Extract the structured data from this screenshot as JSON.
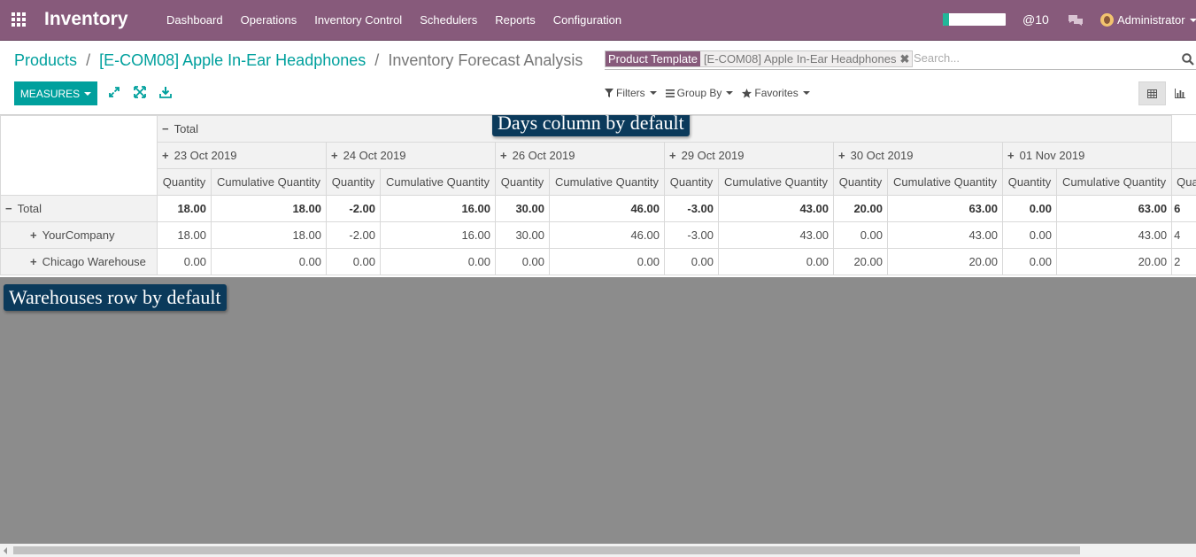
{
  "navbar": {
    "brand": "Inventory",
    "menu": [
      "Dashboard",
      "Operations",
      "Inventory Control",
      "Schedulers",
      "Reports",
      "Configuration"
    ],
    "progress_fraction": 0.1,
    "mentions": "@10",
    "user": "Administrator"
  },
  "breadcrumb": {
    "items": [
      "Products",
      "[E-COM08] Apple In-Ear Headphones"
    ],
    "separator": "/",
    "current": "Inventory Forecast Analysis"
  },
  "search": {
    "facet_label": "Product Template",
    "facet_value": "[E-COM08] Apple In-Ear Headphones",
    "facet_remove": "✖",
    "placeholder": "Search..."
  },
  "toolbar": {
    "measures_label": "MEASURES",
    "filters_label": "Filters",
    "groupby_label": "Group By",
    "favorites_label": "Favorites"
  },
  "pivot": {
    "col_total": "Total",
    "dates": [
      "23 Oct 2019",
      "24 Oct 2019",
      "26 Oct 2019",
      "29 Oct 2019",
      "30 Oct 2019",
      "01 Nov 2019"
    ],
    "measures": [
      "Quantity",
      "Cumulative Quantity"
    ],
    "partial_measure": "Qua",
    "rows": [
      {
        "label": "Total",
        "values": [
          "18.00",
          "18.00",
          "-2.00",
          "16.00",
          "30.00",
          "46.00",
          "-3.00",
          "43.00",
          "20.00",
          "63.00",
          "0.00",
          "63.00"
        ],
        "partial": "6"
      },
      {
        "label": "YourCompany",
        "values": [
          "18.00",
          "18.00",
          "-2.00",
          "16.00",
          "30.00",
          "46.00",
          "-3.00",
          "43.00",
          "0.00",
          "43.00",
          "0.00",
          "43.00"
        ],
        "partial": "4"
      },
      {
        "label": "Chicago Warehouse",
        "values": [
          "0.00",
          "0.00",
          "0.00",
          "0.00",
          "0.00",
          "0.00",
          "0.00",
          "0.00",
          "20.00",
          "20.00",
          "0.00",
          "20.00"
        ],
        "partial": "2"
      }
    ]
  },
  "annotations": {
    "days": "Days column by default",
    "warehouses": "Warehouses row by default"
  },
  "colors": {
    "navbar": "#875a7b",
    "accent": "#00a09d",
    "callout": "#0b3a5b",
    "overlay": "#8c8c8c"
  },
  "icons": [
    "apps-icon",
    "chat-icon",
    "search-icon",
    "expand-icon",
    "fullscreen-icon",
    "download-icon",
    "filter-icon",
    "list-icon",
    "star-icon",
    "pivot-view-icon",
    "graph-view-icon"
  ]
}
